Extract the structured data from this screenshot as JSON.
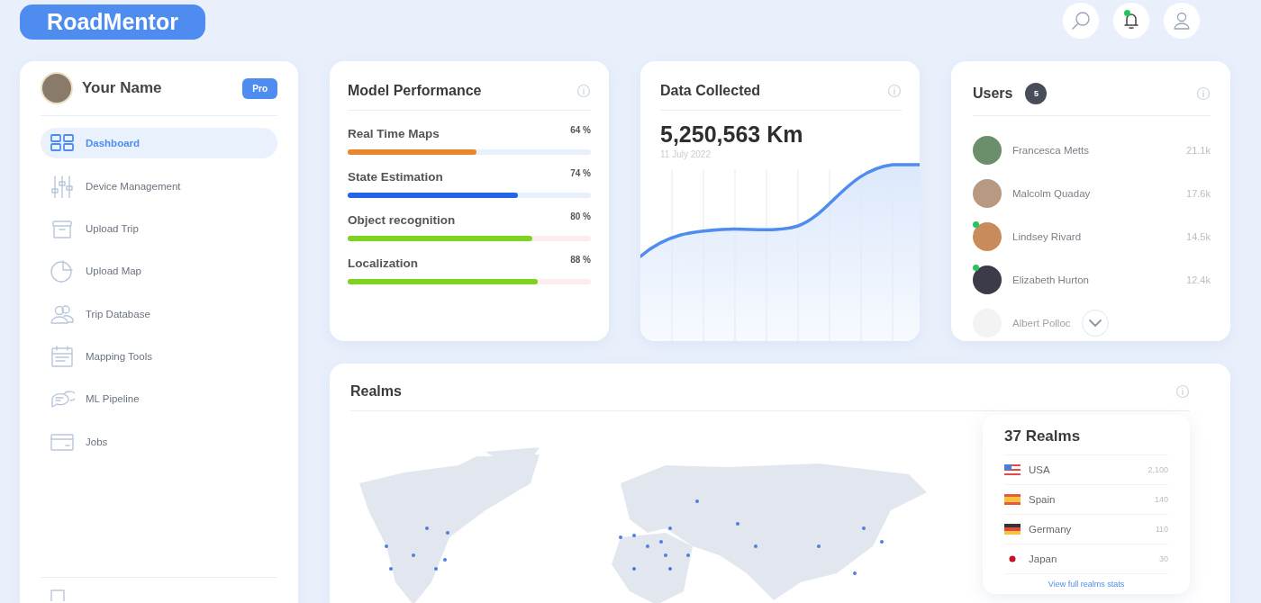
{
  "header": {
    "logo": "RoadMentor",
    "notification": true
  },
  "profile": {
    "name": "Your Name",
    "badge": "Pro"
  },
  "sidebar": {
    "items": [
      {
        "label": "Dashboard",
        "selected": true
      },
      {
        "label": "Device Management",
        "selected": false
      },
      {
        "label": "Upload Trip",
        "selected": false
      },
      {
        "label": "Upload Map",
        "selected": false
      },
      {
        "label": "Trip Database",
        "selected": false
      },
      {
        "label": "Mapping Tools",
        "selected": false
      },
      {
        "label": "ML Pipeline",
        "selected": false
      },
      {
        "label": "Jobs",
        "selected": false
      }
    ]
  },
  "model_performance": {
    "title": "Model Performance",
    "metrics": [
      {
        "name": "Real Time Maps",
        "reading": "64 %",
        "level": 0.53,
        "color": "#e8862e"
      },
      {
        "name": "State Estimation",
        "reading": "74 %",
        "level": 0.7,
        "color": "#2563eb"
      },
      {
        "name": "Object recognition",
        "reading": "80 %",
        "level": 0.76,
        "color": "#7ed321"
      },
      {
        "name": "Localization",
        "reading": "88 %",
        "level": 0.78,
        "color": "#7ed321"
      }
    ]
  },
  "data_collected": {
    "title": "Data Collected",
    "value": "5,250,563 Km",
    "date": "11 July 2022"
  },
  "users": {
    "title": "Users",
    "count": "5",
    "rows": [
      {
        "name": "Francesca Metts",
        "value": "21.1k",
        "online": false
      },
      {
        "name": "Malcolm Quaday",
        "value": "17.6k",
        "online": false
      },
      {
        "name": "Lindsey Rivard",
        "value": "14.5k",
        "online": true
      },
      {
        "name": "Elizabeth Hurton",
        "value": "12.4k",
        "online": true
      },
      {
        "name": "Albert Polloc",
        "online": false
      }
    ]
  },
  "realms": {
    "title": "Realms",
    "summary_title": "37 Realms",
    "countries": [
      {
        "name": "USA",
        "value": "2,100"
      },
      {
        "name": "Spain",
        "value": "140"
      },
      {
        "name": "Germany",
        "value": "110"
      },
      {
        "name": "Japan",
        "value": "30"
      }
    ],
    "link": "View full realms stats"
  }
}
